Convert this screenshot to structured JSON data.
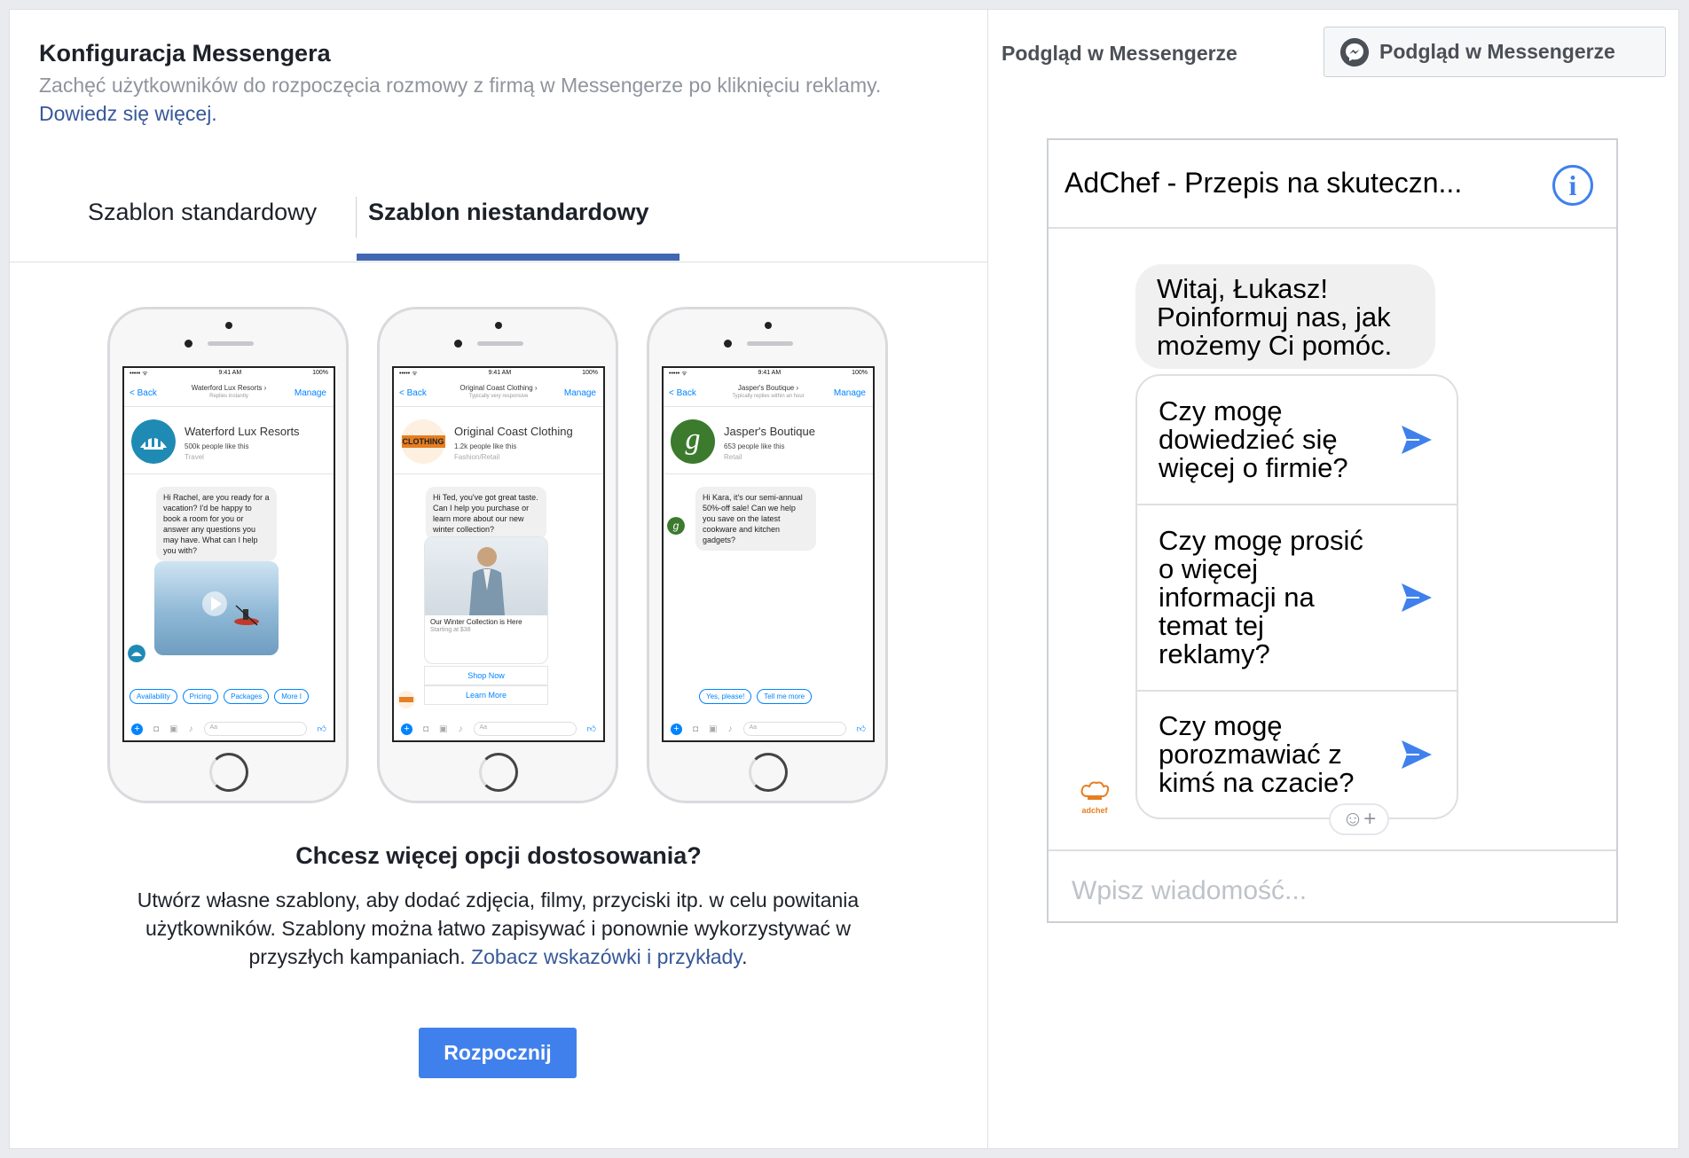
{
  "left": {
    "title": "Konfiguracja Messengera",
    "subtitle_text": "Zachęć użytkowników do rozpoczęcia rozmowy z firmą w Messengerze po kliknięciu reklamy. ",
    "subtitle_link": "Dowiedz się więcej.",
    "tabs": [
      {
        "label": "Szablon standardowy",
        "active": false
      },
      {
        "label": "Szablon niestandardowy",
        "active": true
      }
    ],
    "promo_title": "Chcesz więcej opcji dostosowania?",
    "promo_text": "Utwórz własne szablony, aby dodać zdjęcia, filmy, przyciski itp. w celu powitania użytkowników. Szablony można łatwo zapisywać i ponownie wykorzystywać w przyszłych kampaniach. ",
    "promo_link": "Zobacz wskazówki i przykłady",
    "promo_end": ".",
    "start_button": "Rozpocznij"
  },
  "phones": [
    {
      "time": "9:41 AM",
      "battery": "100%",
      "signal": "••••• ᯤ",
      "back": "< Back",
      "name": "Waterford Lux Resorts ›",
      "hint": "Replies instantly",
      "manage": "Manage",
      "biz_name": "Waterford Lux Resorts",
      "likes": "500k people like this",
      "category": "Travel",
      "message": "Hi Rachel, are you ready for a vacation? I'd be happy to book a room for you or answer any questions you may have. What can I help you with?",
      "chips": [
        "Availability",
        "Pricing",
        "Packages",
        "More I"
      ],
      "composer": "Aa",
      "color": "#1f8bb5"
    },
    {
      "time": "9:41 AM",
      "battery": "100%",
      "signal": "••••• ᯤ",
      "back": "< Back",
      "name": "Original Coast Clothing ›",
      "hint": "Typically very responsive",
      "manage": "Manage",
      "biz_name": "Original Coast Clothing",
      "likes": "1.2k people like this",
      "category": "Fashion/Retail",
      "logo_text": "CLOTHING",
      "message": "Hi Ted, you've got great taste. Can I help you purchase or learn more about our new winter collection?",
      "card_title": "Our Winter Collection is Here",
      "card_sub": "Starting at $38",
      "card_btn1": "Shop Now",
      "card_btn2": "Learn More",
      "composer": "Aa",
      "color": "#e67e22"
    },
    {
      "time": "9:41 AM",
      "battery": "100%",
      "signal": "••••• ᯤ",
      "back": "< Back",
      "name": "Jasper's Boutique ›",
      "hint": "Typically replies within an hour",
      "manage": "Manage",
      "biz_name": "Jasper's Boutique",
      "likes": "653 people like this",
      "category": "Retail",
      "logo_letter": "g",
      "message": "Hi Kara, it's our semi-annual 50%-off sale! Can we help you save on the latest cookware and kitchen gadgets?",
      "chips": [
        "Yes, please!",
        "Tell me more"
      ],
      "composer": "Aa",
      "color": "#3c7a2e"
    }
  ],
  "right": {
    "title": "Podgląd w Messengerze",
    "preview_button": "Podgląd w Messengerze",
    "chat_title": "AdChef - Przepis na skuteczn...",
    "info_symbol": "i",
    "greeting": "Witaj, Łukasz! Poinformuj nas, jak możemy Ci pomóc.",
    "replies": [
      "Czy mogę dowiedzieć się więcej o firmie?",
      "Czy mogę prosić o więcej informacji na temat tej reklamy?",
      "Czy mogę porozmawiać z kimś na czacie?"
    ],
    "avatar_caption": "adchef",
    "emoji_button": "☺+",
    "input_placeholder": "Wpisz wiadomość..."
  },
  "colors": {
    "accent": "#4267b2",
    "button": "#4080ec",
    "link": "#365899",
    "messenger_blue": "#4080ec"
  },
  "icons": [
    "messenger-icon",
    "info-icon",
    "send-icon",
    "emoji-icon",
    "plus-icon",
    "camera-icon",
    "like-icon"
  ]
}
